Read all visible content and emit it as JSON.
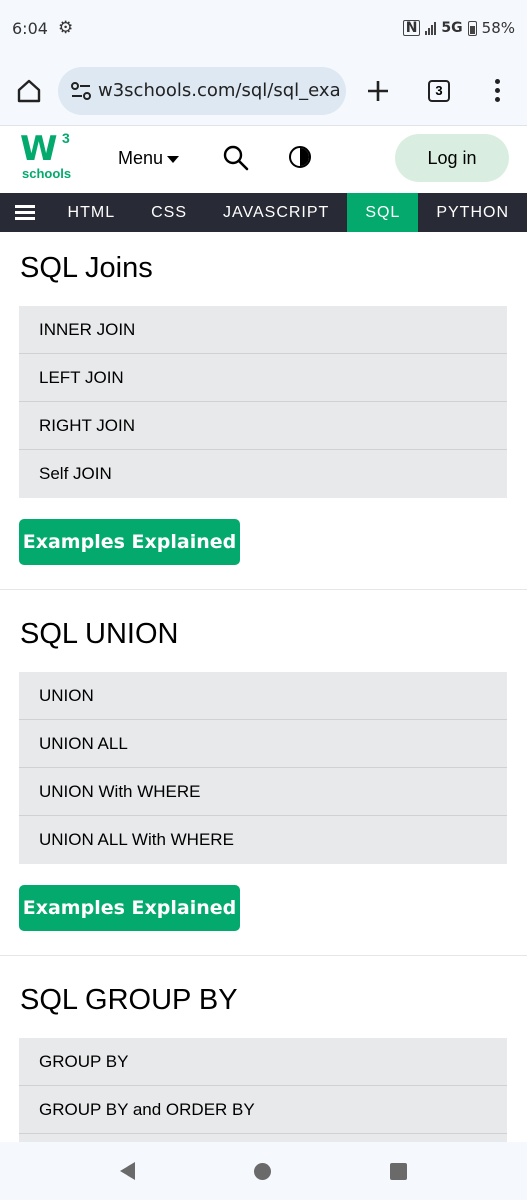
{
  "status_bar": {
    "time": "6:04",
    "network": "5G",
    "battery": "58%"
  },
  "browser": {
    "url": "w3schools.com/sql/sql_exa",
    "tab_count": "3"
  },
  "site_header": {
    "logo_mark": "W",
    "logo_sup": "3",
    "logo_text": "schools",
    "menu_label": "Menu",
    "login_label": "Log in"
  },
  "topnav": {
    "items": [
      "HTML",
      "CSS",
      "JAVASCRIPT",
      "SQL",
      "PYTHON"
    ],
    "active": "SQL"
  },
  "sections": [
    {
      "title": "SQL Joins",
      "items": [
        "INNER JOIN",
        "LEFT JOIN",
        "RIGHT JOIN",
        "Self JOIN"
      ],
      "button": "Examples Explained"
    },
    {
      "title": "SQL UNION",
      "items": [
        "UNION",
        "UNION ALL",
        "UNION With WHERE",
        "UNION ALL With WHERE"
      ],
      "button": "Examples Explained"
    },
    {
      "title": "SQL GROUP BY",
      "items": [
        "GROUP BY",
        "GROUP BY and ORDER BY"
      ]
    }
  ],
  "colors": {
    "brand_green": "#04aa6d",
    "nav_dark": "#282a35",
    "list_bg": "#e7e9eb"
  },
  "icons": {
    "home": "home-icon",
    "site_settings": "tune-icon",
    "new_tab": "plus-icon",
    "more": "more-vert-icon",
    "search": "search-icon",
    "theme": "contrast-icon"
  }
}
